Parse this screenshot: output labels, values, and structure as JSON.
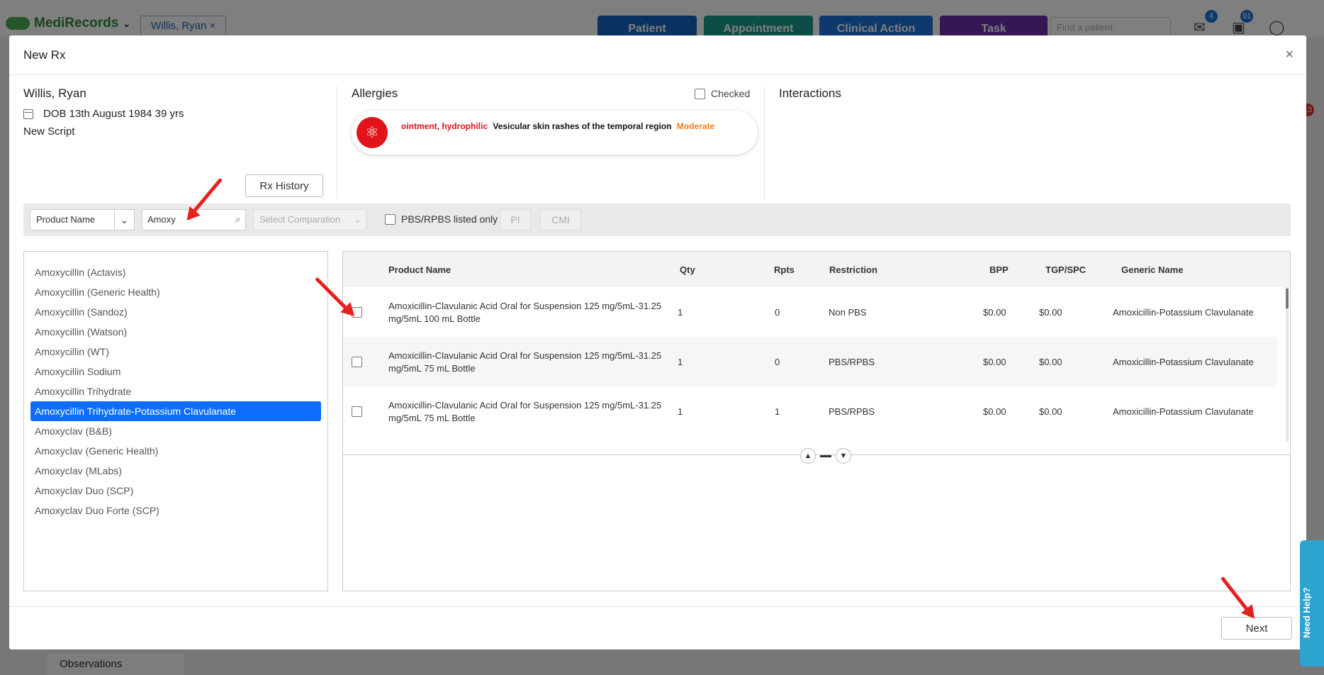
{
  "background_app": {
    "logo": "MediRecords",
    "patient_tab": "Willis, Ryan",
    "buttons": [
      {
        "label": "Patient",
        "color": "#1565c0"
      },
      {
        "label": "Appointment",
        "color": "#1a9b8f"
      },
      {
        "label": "Clinical Action",
        "color": "#1e73d8"
      },
      {
        "label": "Task",
        "color": "#6a2fa8"
      }
    ],
    "search_placeholder": "Find a patient",
    "mail_badge": "4",
    "task_badge": "91",
    "side_badge": "13",
    "bottom_nav_item": "Observations"
  },
  "modal": {
    "title": "New Rx",
    "close_symbol": "×",
    "patient": {
      "name": "Willis, Ryan",
      "dob": "DOB 13th August 1984 39 yrs",
      "script_type": "New Script"
    },
    "rx_history_label": "Rx History",
    "allergies": {
      "title": "Allergies",
      "checked_label": "Checked",
      "items": [
        {
          "name": "ointment, hydrophilic",
          "reaction": "Vesicular skin rashes of the temporal region",
          "severity": "Moderate"
        }
      ]
    },
    "interactions_title": "Interactions",
    "toolbar": {
      "product_select": "Product Name",
      "search_value": "Amoxy",
      "comparation_placeholder": "Select Comparation",
      "pbs_label": "PBS/RPBS listed only",
      "pi_label": "PI",
      "cmi_label": "CMI"
    },
    "product_list": [
      "Amoxycillin (Actavis)",
      "Amoxycillin (Generic Health)",
      "Amoxycillin (Sandoz)",
      "Amoxycillin (Watson)",
      "Amoxycillin (WT)",
      "Amoxycillin Sodium",
      "Amoxycillin Trihydrate",
      "Amoxycillin Trihydrate-Potassium Clavulanate",
      "Amoxyclav (B&B)",
      "Amoxyclav (Generic Health)",
      "Amoxyclav (MLabs)",
      "Amoxyclav Duo (SCP)",
      "Amoxyclav Duo Forte (SCP)"
    ],
    "selected_product_index": 7,
    "table": {
      "headers": [
        "Product Name",
        "Qty",
        "Rpts",
        "Restriction",
        "BPP",
        "TGP/SPC",
        "Generic Name"
      ],
      "rows": [
        {
          "product": "Amoxicillin-Clavulanic Acid Oral for Suspension 125 mg/5mL-31.25 mg/5mL 100 mL Bottle",
          "qty": "1",
          "rpts": "0",
          "restriction": "Non PBS",
          "bpp": "$0.00",
          "tgp": "$0.00",
          "generic": "Amoxicillin-Potassium Clavulanate"
        },
        {
          "product": "Amoxicillin-Clavulanic Acid Oral for Suspension 125 mg/5mL-31.25 mg/5mL 75 mL Bottle",
          "qty": "1",
          "rpts": "0",
          "restriction": "PBS/RPBS",
          "bpp": "$0.00",
          "tgp": "$0.00",
          "generic": "Amoxicillin-Potassium Clavulanate"
        },
        {
          "product": "Amoxicillin-Clavulanic Acid Oral for Suspension 125 mg/5mL-31.25 mg/5mL 75 mL Bottle",
          "qty": "1",
          "rpts": "1",
          "restriction": "PBS/RPBS",
          "bpp": "$0.00",
          "tgp": "$0.00",
          "generic": "Amoxicillin-Potassium Clavulanate"
        }
      ]
    },
    "next_label": "Next"
  },
  "need_help_label": "Need Help?",
  "colors": {
    "accent": "#0d6efd",
    "allergy_red": "#e0141a",
    "severity_orange": "#f07d1a",
    "annotation_arrow": "#e8201d"
  }
}
